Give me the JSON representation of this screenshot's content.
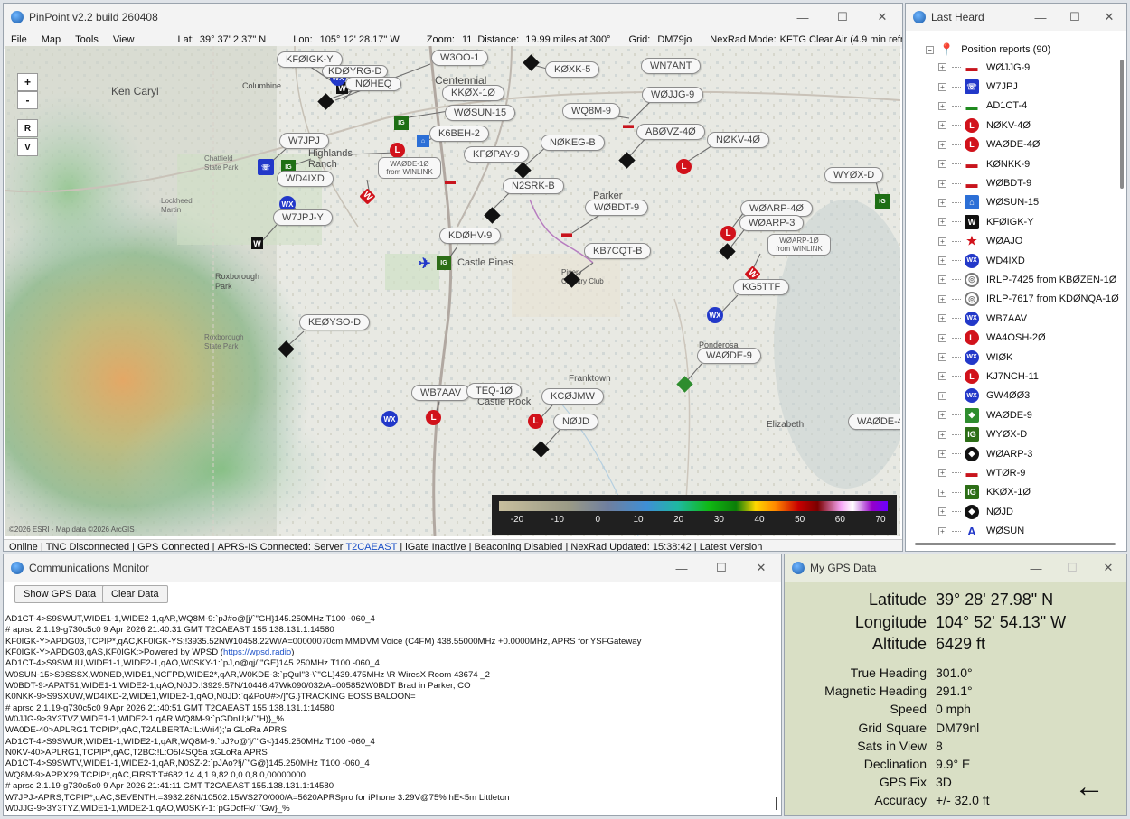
{
  "main_window": {
    "title": "PinPoint v2.2 build 260408",
    "menu": [
      "File",
      "Map",
      "Tools",
      "View"
    ],
    "lat_label": "Lat:",
    "lat_value": "39° 37' 2.37\" N",
    "lon_label": "Lon:",
    "lon_value": "105° 12' 28.17\" W",
    "zoom_label": "Zoom:",
    "zoom_value": "11",
    "distance_label": "Distance:",
    "distance_value": "19.99 miles at 300°",
    "grid_label": "Grid:",
    "grid_value": "DM79jo",
    "nexrad_label": "NexRad Mode:",
    "nexrad_value": "KFTG Clear Air (4.9 min refresh)"
  },
  "map": {
    "zoom_in": "+",
    "zoom_out": "-",
    "btn_r": "R",
    "btn_v": "V",
    "copyright": "©2026 ESRI - Map data ©2026 ArcGIS",
    "places": [
      "Ken Caryl",
      "Columbine",
      "Centennial",
      "Highlands Ranch",
      "Parker",
      "Roxborough Park",
      "Castle Pines",
      "Castle Rock",
      "Franktown",
      "Elizabeth",
      "Ponderosa",
      "Pinery Country Club",
      "Lockheed Martin",
      "Chatfield State Park",
      "Roxborough State Park"
    ],
    "callouts": [
      "KFØIGK-Y",
      "KDØYRG-D",
      "NØHEQ",
      "W3OO-1",
      "KØXK-5",
      "WN7ANT",
      "KKØX-1Ø",
      "WØJJG-9",
      "WØSUN-15",
      "WQ8M-9",
      "K6BEH-2",
      "ABØVZ-4Ø",
      "NØKV-4Ø",
      "W7JPJ",
      "NØKEG-B",
      "KFØPAY-9",
      "WD4IXD",
      "N2SRK-B",
      "WYØX-D",
      "W7JPJ-Y",
      "WØBDT-9",
      "WØARP-4Ø",
      "WØARP-3",
      "KDØHV-9",
      "KB7CQT-B",
      "KG5TTF",
      "KEØYSO-D",
      "WAØDE-9",
      "WB7AAV",
      "TEQ-1Ø",
      "KCØJMW",
      "NØJD",
      "WAØDE-4"
    ],
    "winlink_1": "WAØDE-1Ø from WINLINK",
    "winlink_2": "WØARP-1Ø from WINLINK",
    "legend_ticks": [
      "-20",
      "-10",
      "0",
      "10",
      "20",
      "30",
      "40",
      "50",
      "60",
      "70"
    ]
  },
  "status_bar": {
    "online": "Online",
    "tnc": "TNC Disconnected",
    "gps": "GPS Connected",
    "aprs_is": "APRS-IS Connected: Server",
    "server": "T2CAEAST",
    "igate": "iGate Inactive",
    "beacon": "Beaconing Disabled",
    "nexrad": "NexRad Updated: 15:38:42",
    "version": "Latest Version"
  },
  "last_heard": {
    "title": "Last Heard",
    "root": "Position reports (90)",
    "items": [
      {
        "label": "WØJJG-9",
        "icon": "car-icon"
      },
      {
        "label": "W7JPJ",
        "icon": "phone-icon"
      },
      {
        "label": "AD1CT-4",
        "icon": "truck-icon"
      },
      {
        "label": "NØKV-4Ø",
        "icon": "lora-icon"
      },
      {
        "label": "WAØDE-4Ø",
        "icon": "lora-icon"
      },
      {
        "label": "KØNKK-9",
        "icon": "car-icon"
      },
      {
        "label": "WØBDT-9",
        "icon": "car-icon"
      },
      {
        "label": "WØSUN-15",
        "icon": "house-icon"
      },
      {
        "label": "KFØIGK-Y",
        "icon": "w-icon"
      },
      {
        "label": "WØAJO",
        "icon": "runner-icon"
      },
      {
        "label": "WD4IXD",
        "icon": "wx-icon"
      },
      {
        "label": "IRLP-7425 from KBØZEN-1Ø",
        "icon": "irlp-icon"
      },
      {
        "label": "IRLP-7617 from KDØNQA-1Ø",
        "icon": "irlp-icon"
      },
      {
        "label": "WB7AAV",
        "icon": "wx-icon"
      },
      {
        "label": "WA4OSH-2Ø",
        "icon": "lora-icon"
      },
      {
        "label": "WIØK",
        "icon": "wx-icon"
      },
      {
        "label": "KJ7NCH-11",
        "icon": "lora-icon"
      },
      {
        "label": "GW4ØØ3",
        "icon": "wx-icon"
      },
      {
        "label": "WAØDE-9",
        "icon": "digi-icon"
      },
      {
        "label": "WYØX-D",
        "icon": "igate-icon"
      },
      {
        "label": "WØARP-3",
        "icon": "diamond-icon"
      },
      {
        "label": "WTØR-9",
        "icon": "bus-icon"
      },
      {
        "label": "KKØX-1Ø",
        "icon": "igate-icon"
      },
      {
        "label": "NØJD",
        "icon": "diamond-icon"
      },
      {
        "label": "WØSUN",
        "icon": "tower-icon"
      }
    ]
  },
  "comm_monitor": {
    "title": "Communications Monitor",
    "show_gps": "Show GPS Data",
    "clear": "Clear Data",
    "lines": [
      "AD1CT-4>S9SWUT,WIDE1-1,WIDE2-1,qAR,WQ8M-9:`pJ#o@[j/`\"GH}145.250MHz T100 -060_4",
      "# aprsc 2.1.19-g730c5c0 9 Apr 2026 21:40:31 GMT T2CAEAST 155.138.131.1:14580",
      "KF0IGK-Y>APDG03,TCPIP*,qAC,KF0IGK-YS:!3935.52NW10458.22Wi/A=00000070cm MMDVM Voice (C4FM) 438.55000MHz +0.0000MHz, APRS for YSFGateway",
      "KF0IGK-Y>APDG03,qAS,KF0IGK:>Powered by WPSD (",
      "AD1CT-4>S9SWUU,WIDE1-1,WIDE2-1,qAO,W0SKY-1:`pJ,o@qj/`\"GE}145.250MHz T100 -060_4",
      "W0SUN-15>S9SSSX,W0NED,WIDE1,NCFPD,WIDE2*,qAR,W0KDE-3:`pQuI\"3-\\`\"GL}439.475MHz \\R WiresX Room 43674 _2",
      "W0BDT-9>APAT51,WIDE1-1,WIDE2-1,qAO,N0JD:!3929.57N/10446.47Wk090/032/A=005852W0BDT Brad in Parker, CO",
      "K0NKK-9>S9SXUW,WD4IXD-2,WIDE1,WIDE2-1,qAO,N0JD:`q&PoU#>/]\"G.}TRACKING EOSS BALOON=",
      "# aprsc 2.1.19-g730c5c0 9 Apr 2026 21:40:51 GMT T2CAEAST 155.138.131.1:14580",
      "W0JJG-9>3Y3TVZ,WIDE1-1,WIDE2-1,qAR,WQ8M-9:`pGDnU;k/`\"H)}_%",
      "WA0DE-40>APLRG1,TCPIP*,qAC,T2ALBERTA:!L:Wri4);'a  GLoRa APRS",
      "AD1CT-4>S9SWUR,WIDE1-1,WIDE2-1,qAR,WQ8M-9:`pJ?o@'j/`\"G<}145.250MHz T100 -060_4",
      "N0KV-40>APLRG1,TCPIP*,qAC,T2BC:!L:O5I4SQ5a xGLoRa APRS",
      "AD1CT-4>S9SWTV,WIDE1-1,WIDE2-1,qAR,N0SZ-2:`pJAo?!j/`\"G@}145.250MHz T100 -060_4",
      "WQ8M-9>APRX29,TCPIP*,qAC,FIRST:T#682,14.4,1.9,82.0,0.0,8.0,00000000",
      "# aprsc 2.1.19-g730c5c0 9 Apr 2026 21:41:11 GMT T2CAEAST 155.138.131.1:14580",
      "W7JPJ>APRS,TCPIP*,qAC,SEVENTH:=3932.28N/10502.15WS270/000/A=5620APRSpro for iPhone 3.29V@75% hE<5m Littleton",
      "W0JJG-9>3Y3TYZ,WIDE1-1,WIDE2-1,qAO,W0SKY-1:`pGDofFk/`\"Gw}_%"
    ],
    "link_text": "https://wpsd.radio",
    "link_suffix": ")"
  },
  "gps": {
    "title": "My GPS Data",
    "rows_big": [
      {
        "k": "Latitude",
        "v": "39° 28' 27.98\" N"
      },
      {
        "k": "Longitude",
        "v": "104° 52' 54.13\" W"
      },
      {
        "k": "Altitude",
        "v": "6429 ft"
      }
    ],
    "rows": [
      {
        "k": "True Heading",
        "v": "301.0°"
      },
      {
        "k": "Magnetic Heading",
        "v": "291.1°"
      },
      {
        "k": "Speed",
        "v": "0 mph"
      },
      {
        "k": "Grid Square",
        "v": "DM79nl"
      },
      {
        "k": "Sats in View",
        "v": "8"
      },
      {
        "k": "Declination",
        "v": "9.9° E"
      },
      {
        "k": "GPS Fix",
        "v": "3D"
      },
      {
        "k": "Accuracy",
        "v": "+/- 32.0 ft"
      }
    ],
    "heading_arrow": "←"
  },
  "colors": {
    "gps_bg": "#d9dfc5",
    "link": "#1a4fc7",
    "wx": "#2238c9",
    "lora": "#d1121b"
  }
}
